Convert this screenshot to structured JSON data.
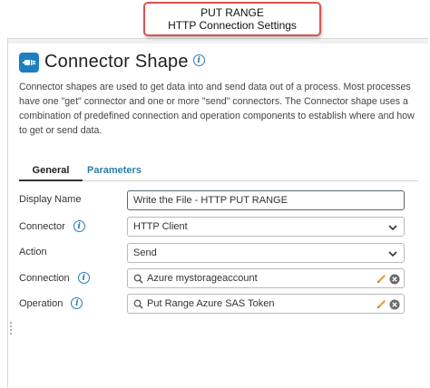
{
  "callout": {
    "line1": "PUT RANGE",
    "line2": "HTTP Connection Settings"
  },
  "header": {
    "title": "Connector Shape",
    "icon": "connector-shape-icon",
    "info_icon": "info-icon"
  },
  "description": "Connector shapes are used to get data into and send data out of a process. Most processes have one \"get\" connector and one or more \"send\" connectors. The Connector shape uses a combination of predefined connection and operation components to establish where and how to get or send data.",
  "tabs": [
    {
      "label": "General",
      "active": true
    },
    {
      "label": "Parameters",
      "active": false
    }
  ],
  "fields": {
    "display_name": {
      "label": "Display Name",
      "value": "Write the File - HTTP PUT RANGE"
    },
    "connector": {
      "label": "Connector",
      "value": "HTTP Client"
    },
    "action": {
      "label": "Action",
      "value": "Send"
    },
    "connection": {
      "label": "Connection",
      "value": "Azure mystorageaccount"
    },
    "operation": {
      "label": "Operation",
      "value": "Put Range Azure SAS Token"
    }
  },
  "colors": {
    "accent": "#1e7fc0",
    "tab_link": "#2b7fa8",
    "callout_border": "#d9534f",
    "edit_pencil": "#e8a33a"
  }
}
